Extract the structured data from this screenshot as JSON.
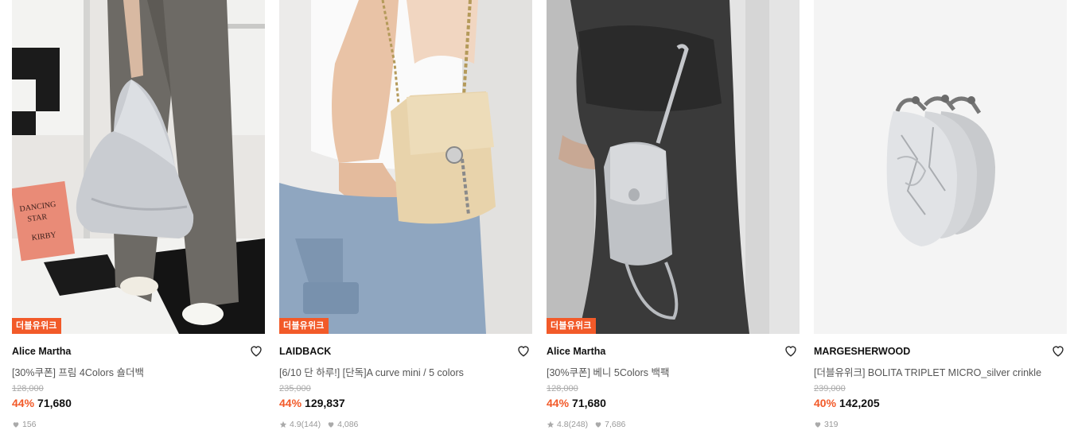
{
  "products": [
    {
      "badge": "더블유위크",
      "brand": "Alice Martha",
      "title": "[30%쿠폰] 프림 4Colors 숄더백",
      "original_price": "128,000",
      "discount": "44%",
      "price": "71,680",
      "rating": "",
      "review_count": "",
      "likes": "156",
      "book_text": [
        "DANCING",
        "STAR",
        "KIRBY"
      ]
    },
    {
      "badge": "더블유위크",
      "brand": "LAIDBACK",
      "title": "[6/10 단 하루!] [단독]A curve mini / 5 colors",
      "original_price": "235,000",
      "discount": "44%",
      "price": "129,837",
      "rating": "4.9",
      "review_count": "(144)",
      "likes": "4,086"
    },
    {
      "badge": "더블유위크",
      "brand": "Alice Martha",
      "title": "[30%쿠폰] 베니 5Colors 백팩",
      "original_price": "128,000",
      "discount": "44%",
      "price": "71,680",
      "rating": "4.8",
      "review_count": "(248)",
      "likes": "7,686"
    },
    {
      "badge": "",
      "brand": "MARGESHERWOOD",
      "title": "[더블유위크] BOLITA TRIPLET MICRO_silver crinkle",
      "original_price": "239,000",
      "discount": "40%",
      "price": "142,205",
      "rating": "",
      "review_count": "",
      "likes": "319"
    }
  ],
  "colors": {
    "accent": "#f25a29",
    "text": "#111111",
    "muted": "#999999"
  }
}
